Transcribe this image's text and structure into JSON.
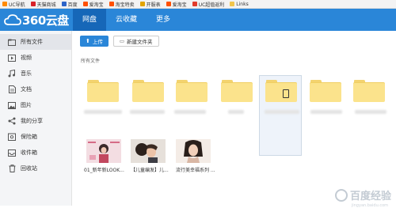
{
  "bookmarks": [
    {
      "label": "UC导航",
      "color": "#ff8a00"
    },
    {
      "label": "天猫商城",
      "color": "#d8232a"
    },
    {
      "label": "百度",
      "color": "#2d64c8"
    },
    {
      "label": "爱淘宝",
      "color": "#ff5000"
    },
    {
      "label": "淘宝特卖",
      "color": "#ff5000"
    },
    {
      "label": "开服表",
      "color": "#e2a400"
    },
    {
      "label": "爱淘宝",
      "color": "#ff5000"
    },
    {
      "label": "UC超值返利",
      "color": "#e23c2c"
    },
    {
      "label": "Links",
      "color": "#f2c54b"
    }
  ],
  "header": {
    "logo_text": "360云盘",
    "nav": [
      {
        "label": "网盘",
        "active": true
      },
      {
        "label": "云收藏",
        "active": false
      },
      {
        "label": "更多",
        "active": false
      }
    ]
  },
  "sidebar": {
    "items": [
      {
        "label": "所有文件",
        "icon": "folder-icon",
        "active": true
      },
      {
        "label": "视频",
        "icon": "video-icon",
        "active": false
      },
      {
        "label": "音乐",
        "icon": "music-icon",
        "active": false
      },
      {
        "label": "文档",
        "icon": "document-icon",
        "active": false
      },
      {
        "label": "图片",
        "icon": "image-icon",
        "active": false
      },
      {
        "label": "我的分享",
        "icon": "share-icon",
        "active": false
      },
      {
        "label": "保险箱",
        "icon": "safe-icon",
        "active": false
      },
      {
        "label": "收件箱",
        "icon": "inbox-icon",
        "active": false
      },
      {
        "label": "回收站",
        "icon": "trash-icon",
        "active": false
      }
    ]
  },
  "toolbar": {
    "upload_label": "上传",
    "new_folder_label": "新建文件夹"
  },
  "breadcrumb": "所有文件",
  "thumbnails": [
    {
      "caption": "01_新年新LOOK..."
    },
    {
      "caption": "【儿童编发】儿..."
    },
    {
      "caption": "流行美幸福系列 ..."
    }
  ],
  "watermark": {
    "text": "百度经验",
    "sub": "jingyan.baidu.com"
  },
  "colors": {
    "header": "#2a86d8",
    "nav_active": "#1667b8",
    "folder": "#fbe38c"
  }
}
